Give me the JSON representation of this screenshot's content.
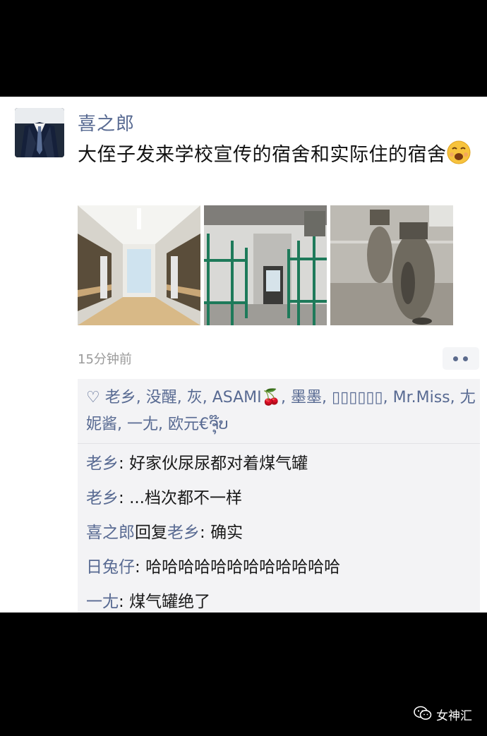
{
  "post": {
    "author": "喜之郎",
    "text": "大侄子发来学校宣传的宿舍和实际住的宿舍",
    "emoji": "grimacing-face",
    "photos": [
      "dorm-promo-photo",
      "dorm-bunkbed-photo",
      "gas-cylinder-photo"
    ],
    "time": "15分钟前"
  },
  "likes": {
    "icon": "heart-icon",
    "names": "老乡, 没醒, 灰, ASAMI🍒, 墨墨, ▯▯▯▯▯▯, Mr.Miss, 尢妮酱, 一尢, 欧元€ຈຸ໊ບ"
  },
  "comments": [
    {
      "author": "老乡",
      "sep": ": ",
      "text": "好家伙尿尿都对着煤气罐"
    },
    {
      "author": "老乡",
      "sep": ": ",
      "text": "...档次都不一样"
    },
    {
      "author": "喜之郎",
      "reply_word": "回复",
      "reply_to": "老乡",
      "sep": ": ",
      "text": "确实"
    },
    {
      "author": "日兔仔",
      "sep": ": ",
      "text": "哈哈哈哈哈哈哈哈哈哈哈哈"
    },
    {
      "author": "一尢",
      "sep": ": ",
      "text": "煤气罐绝了"
    }
  ],
  "watermark": {
    "label": "女神汇"
  },
  "colors": {
    "name_blue": "#586a92",
    "background": "#000000",
    "card": "#ffffff",
    "comment_bg": "#f3f3f5"
  }
}
